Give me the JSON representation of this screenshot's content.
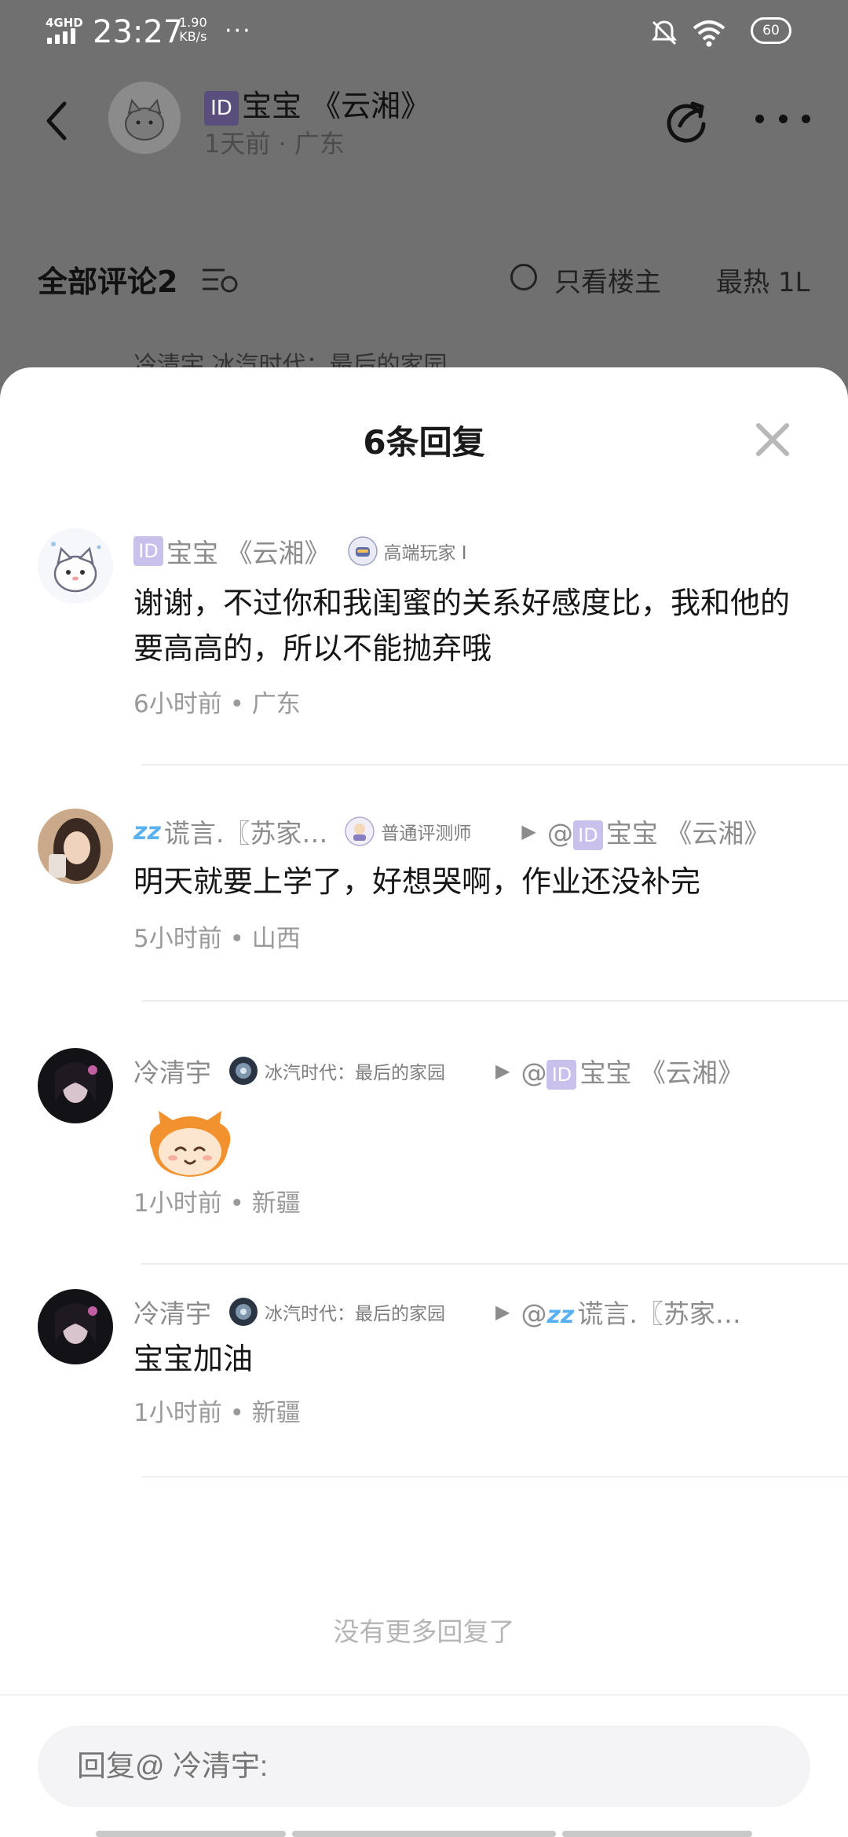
{
  "status_bar": {
    "network": "4GHD",
    "time": "23:27",
    "speed_value": "1.90",
    "speed_unit": "KB/s",
    "overflow": "···",
    "battery": "60"
  },
  "post_header": {
    "author_name": "宝宝 《云湘》",
    "author_meta": "1天前 · 广东"
  },
  "comment_bar": {
    "title": "全部评论2",
    "only_op": "只看楼主",
    "sort": "最热",
    "sort_extra": "1L"
  },
  "bg_peek_user": "冷清宇 冰汽时代：最后的家园",
  "sheet": {
    "title": "6条回复",
    "no_more": "没有更多回复了",
    "input_placeholder": "回复@ 冷清宇:"
  },
  "id_tag": "ID",
  "replies": [
    {
      "user": "宝宝 《云湘》",
      "badge": "高端玩家 I",
      "text": "谢谢，不过你和我闺蜜的关系好感度比，我和他的要高高的，所以不能抛弃哦",
      "meta": "6小时前 • 广东"
    },
    {
      "user": "谎言.〖苏家…",
      "badge": "普通评测师",
      "reply_to_prefix": "@",
      "reply_to": "宝宝 《云湘》",
      "text": "明天就要上学了，好想哭啊，作业还没补完",
      "meta": "5小时前 • 山西"
    },
    {
      "user": "冷清宇",
      "badge": "冰汽时代：最后的家园",
      "reply_to_prefix": "@",
      "reply_to": "宝宝 《云湘》",
      "sticker": "orange-cat-sticker",
      "meta": "1小时前 • 新疆"
    },
    {
      "user": "冷清宇",
      "badge": "冰汽时代：最后的家园",
      "reply_to_prefix": "@",
      "reply_to": "谎言.〖苏家…",
      "text": "宝宝加油",
      "meta": "1小时前 • 新疆"
    }
  ],
  "colors": {
    "overlay": "#707070",
    "sheet_bg": "#ffffff",
    "id_tag": "#c9c0ec",
    "muted_text": "#8c8c8c"
  }
}
